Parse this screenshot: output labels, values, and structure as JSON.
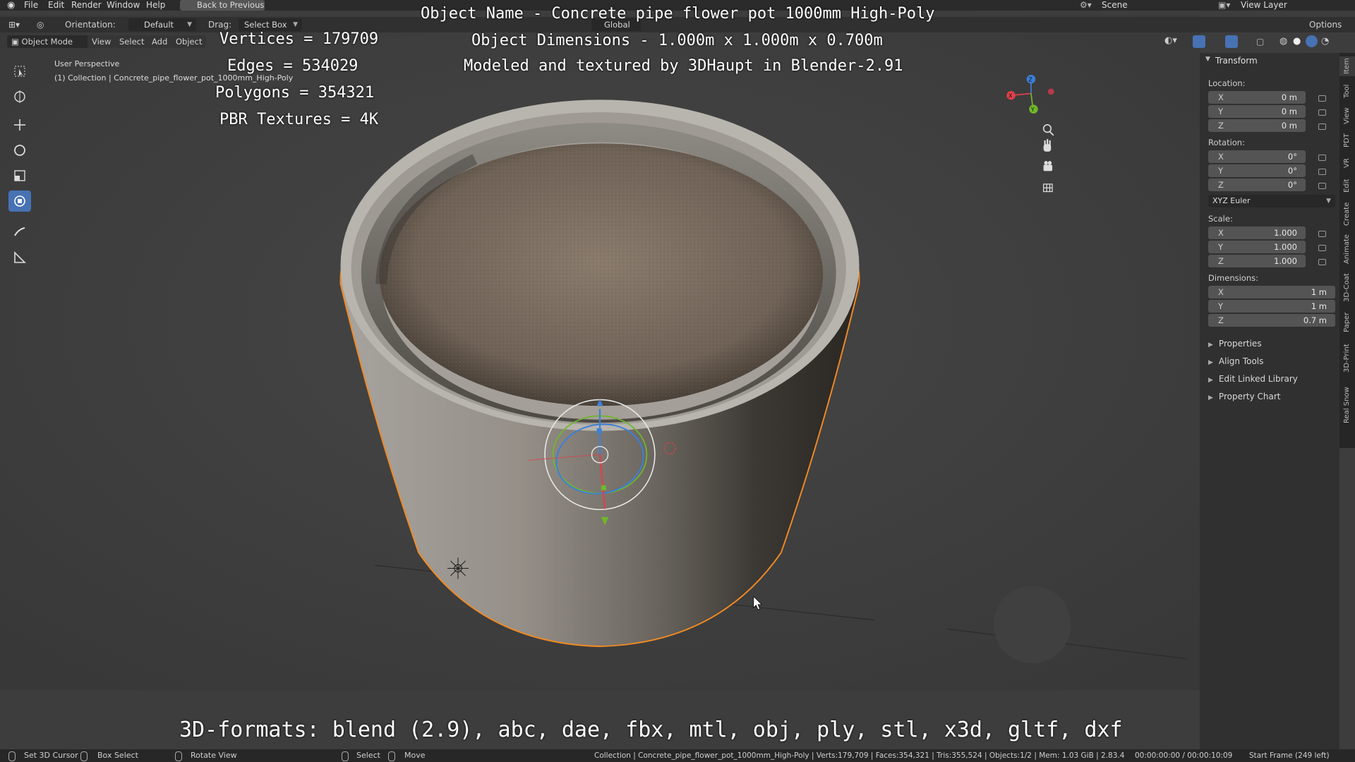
{
  "menu": [
    "File",
    "Edit",
    "Render",
    "Window",
    "Help"
  ],
  "back_button": "Back to Previous",
  "scene_label": "Scene",
  "view_layer_label": "View Layer",
  "header": {
    "orientation_label": "Orientation:",
    "orientation_value": "Default",
    "drag_label": "Drag:",
    "drag_value": "Select Box",
    "transform_space": "Global",
    "options": "Options"
  },
  "header2": {
    "mode": "Object Mode",
    "view": "View",
    "select": "Select",
    "add": "Add",
    "object": "Object"
  },
  "viewport_info": {
    "perspective": "User Perspective",
    "collection": "(1) Collection | Concrete_pipe_flower_pot_1000mm_High-Poly"
  },
  "overlay": {
    "vertices": "Vertices = 179709",
    "edges": "Edges = 534029",
    "polygons": "Polygons = 354321",
    "pbr": "PBR Textures = 4K",
    "object_name": "Object Name - Concrete pipe flower pot 1000mm High-Poly",
    "dimensions": "Object Dimensions -  1.000m x 1.000m x 0.700m",
    "modeled_by": "Modeled and textured by 3DHaupt in Blender-2.91",
    "formats": "3D-formats: blend (2.9), abc, dae, fbx, mtl, obj, ply, stl, x3d, gltf, dxf"
  },
  "transform": {
    "title": "Transform",
    "location_label": "Location:",
    "location": [
      {
        "axis": "X",
        "value": "0 m"
      },
      {
        "axis": "Y",
        "value": "0 m"
      },
      {
        "axis": "Z",
        "value": "0 m"
      }
    ],
    "rotation_label": "Rotation:",
    "rotation": [
      {
        "axis": "X",
        "value": "0°"
      },
      {
        "axis": "Y",
        "value": "0°"
      },
      {
        "axis": "Z",
        "value": "0°"
      }
    ],
    "rotation_mode": "XYZ Euler",
    "scale_label": "Scale:",
    "scale": [
      {
        "axis": "X",
        "value": "1.000"
      },
      {
        "axis": "Y",
        "value": "1.000"
      },
      {
        "axis": "Z",
        "value": "1.000"
      }
    ],
    "dimensions_label": "Dimensions:",
    "dimensions": [
      {
        "axis": "X",
        "value": "1 m"
      },
      {
        "axis": "Y",
        "value": "1 m"
      },
      {
        "axis": "Z",
        "value": "0.7 m"
      }
    ]
  },
  "panels": [
    "Properties",
    "Align Tools",
    "Edit Linked Library",
    "Property Chart"
  ],
  "vertical_tabs": [
    "Item",
    "Tool",
    "View",
    "PDT",
    "VR",
    "Edit",
    "Create",
    "Animate",
    "3D-Coat",
    "Paper",
    "3D-Print",
    "Real Snow"
  ],
  "status": {
    "set_cursor": "Set 3D Cursor",
    "box_select": "Box Select",
    "rotate_view": "Rotate View",
    "select": "Select",
    "move": "Move",
    "info": "Collection | Concrete_pipe_flower_pot_1000mm_High-Poly | Verts:179,709 | Faces:354,321 | Tris:355,524 | Objects:1/2 | Mem: 1.03 GiB | 2.83.4",
    "timecode": "00:00:00:00 / 00:00:10:09",
    "start_frame": "Start Frame (249 left)"
  },
  "colors": {
    "accent": "#4772b3",
    "selection_outline": "#f08a24",
    "axis_x": "#e0404a",
    "axis_y": "#6fb82a",
    "axis_z": "#3c7fd8"
  }
}
